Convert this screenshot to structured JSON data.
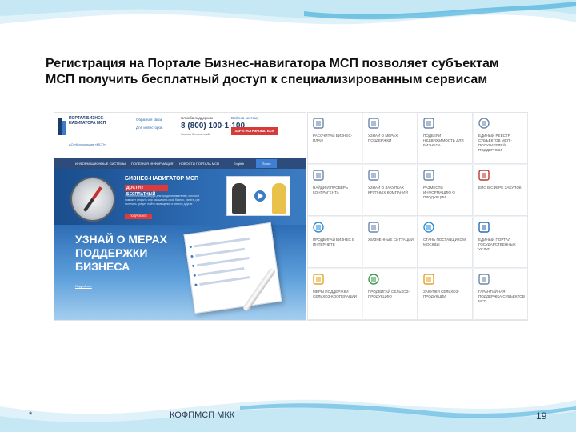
{
  "slide": {
    "title": "Регистрация на Портале Бизнес-навигатора МСП позволяет субъектам МСП получить бесплатный доступ к специализированным сервисам"
  },
  "portal": {
    "logo_text": "ПОРТАЛ БИЗНЕС-НАВИГАТОРА МСП",
    "logo_sub": "АО «Корпорация «МСП»",
    "links": [
      "Обратная связь",
      "Для инвесторов"
    ],
    "phone_label": "Служба поддержки",
    "phone": "8 (800) 100-1-100",
    "phone_note": "Звонок бесплатный",
    "mail_label": "Войти в систему",
    "register_label": "ЗАРЕГИСТРИРОВАТЬСЯ",
    "nav": [
      "ИНФОРМАЦИОННЫЕ СИСТЕМЫ",
      "ПОЛЕЗНАЯ ИНФОРМАЦИЯ",
      "НОВОСТИ ПОРТАЛА МСП",
      "English"
    ],
    "search_label": "Поиск",
    "banner1": {
      "title": "БИЗНЕС-НАВИГАТОР МСП",
      "subtitle": "ДОСТУП БЕСПЛАТНЫЙ",
      "text": "Это бесплатный ресурс для предпринимателей, который поможет открыть или расширить свой бизнес, узнать, где получить кредит, найти помещение и многое другое",
      "button": "ПОДРОБНЕЕ"
    },
    "banner2": {
      "title": "УЗНАЙ О МЕРАХ ПОДДЕРЖКИ БИЗНЕСА",
      "link": "Подробнее"
    }
  },
  "services": [
    {
      "label": "РАССЧИТАЙ БИЗНЕС-ПЛАН",
      "icon": "calculator-icon",
      "color": "#6a86a8"
    },
    {
      "label": "УЗНАЙ О МЕРАХ ПОДДЕРЖКИ",
      "icon": "checklist-icon",
      "color": "#6a86a8"
    },
    {
      "label": "ПОДБЕРИ НЕДВИЖИМОСТЬ ДЛЯ БИЗНЕСА",
      "icon": "building-icon",
      "color": "#6a86a8"
    },
    {
      "label": "ЕДИНЫЙ РЕЕСТР СУБЪЕКТОВ МСП - ПОЛУЧАТЕЛЕЙ ПОДДЕРЖКИ",
      "icon": "globe-icon",
      "color": "#6a86a8"
    },
    {
      "label": "НАЙДИ И ПРОВЕРЬ КОНТРАГЕНТА",
      "icon": "handshake-icon",
      "color": "#6a86a8"
    },
    {
      "label": "УЗНАЙ О ЗАКУПКАХ КРУПНЫХ КОМПАНИЙ",
      "icon": "gavel-icon",
      "color": "#6a86a8"
    },
    {
      "label": "РАЗМЕСТИ ИНФОРМАЦИЮ О ПРОДУКЦИИ",
      "icon": "megaphone-icon",
      "color": "#6a86a8"
    },
    {
      "label": "ЕИС В СФЕРЕ ЗАКУПОК",
      "icon": "emblem-icon",
      "color": "#c0392b"
    },
    {
      "label": "ПРОДВИГАЙ БИЗНЕС В ИНТЕРНЕТЕ",
      "icon": "circle-icon",
      "color": "#2d8fd6"
    },
    {
      "label": "ЖИЗНЕННЫЕ СИТУАЦИИ",
      "icon": "check-icon",
      "color": "#6a86a8"
    },
    {
      "label": "СТАНЬ ПОСТАВЩИКОМ МОСКВЫ",
      "icon": "moscow-icon",
      "color": "#2d8fd6"
    },
    {
      "label": "ЕДИНЫЙ ПОРТАЛ ГОСУДАРСТВЕННЫХ УСЛУГ",
      "icon": "gosuslugi-icon",
      "color": "#2d6bb3"
    },
    {
      "label": "МЕРЫ ПОДДЕРЖКИ СЕЛЬХОЗ-КООПЕРАЦИИ",
      "icon": "farm-icon",
      "color": "#e0a526"
    },
    {
      "label": "ПРОДВИГАЙ СЕЛЬХОЗ-ПРОДУКЦИЮ",
      "icon": "farmer-icon",
      "color": "#3c9a4a"
    },
    {
      "label": "ЗАКУПКИ СЕЛЬХОЗ-ПРОДУКЦИИ",
      "icon": "basket-icon",
      "color": "#e0a526"
    },
    {
      "label": "ГАРАНТИЙНАЯ ПОДДЕРЖКА СУБЪЕКТОВ МСП",
      "icon": "shield-icon",
      "color": "#6a86a8"
    }
  ],
  "footer": {
    "star": "*",
    "center": "КОФПМСП МКК",
    "page": "19"
  }
}
